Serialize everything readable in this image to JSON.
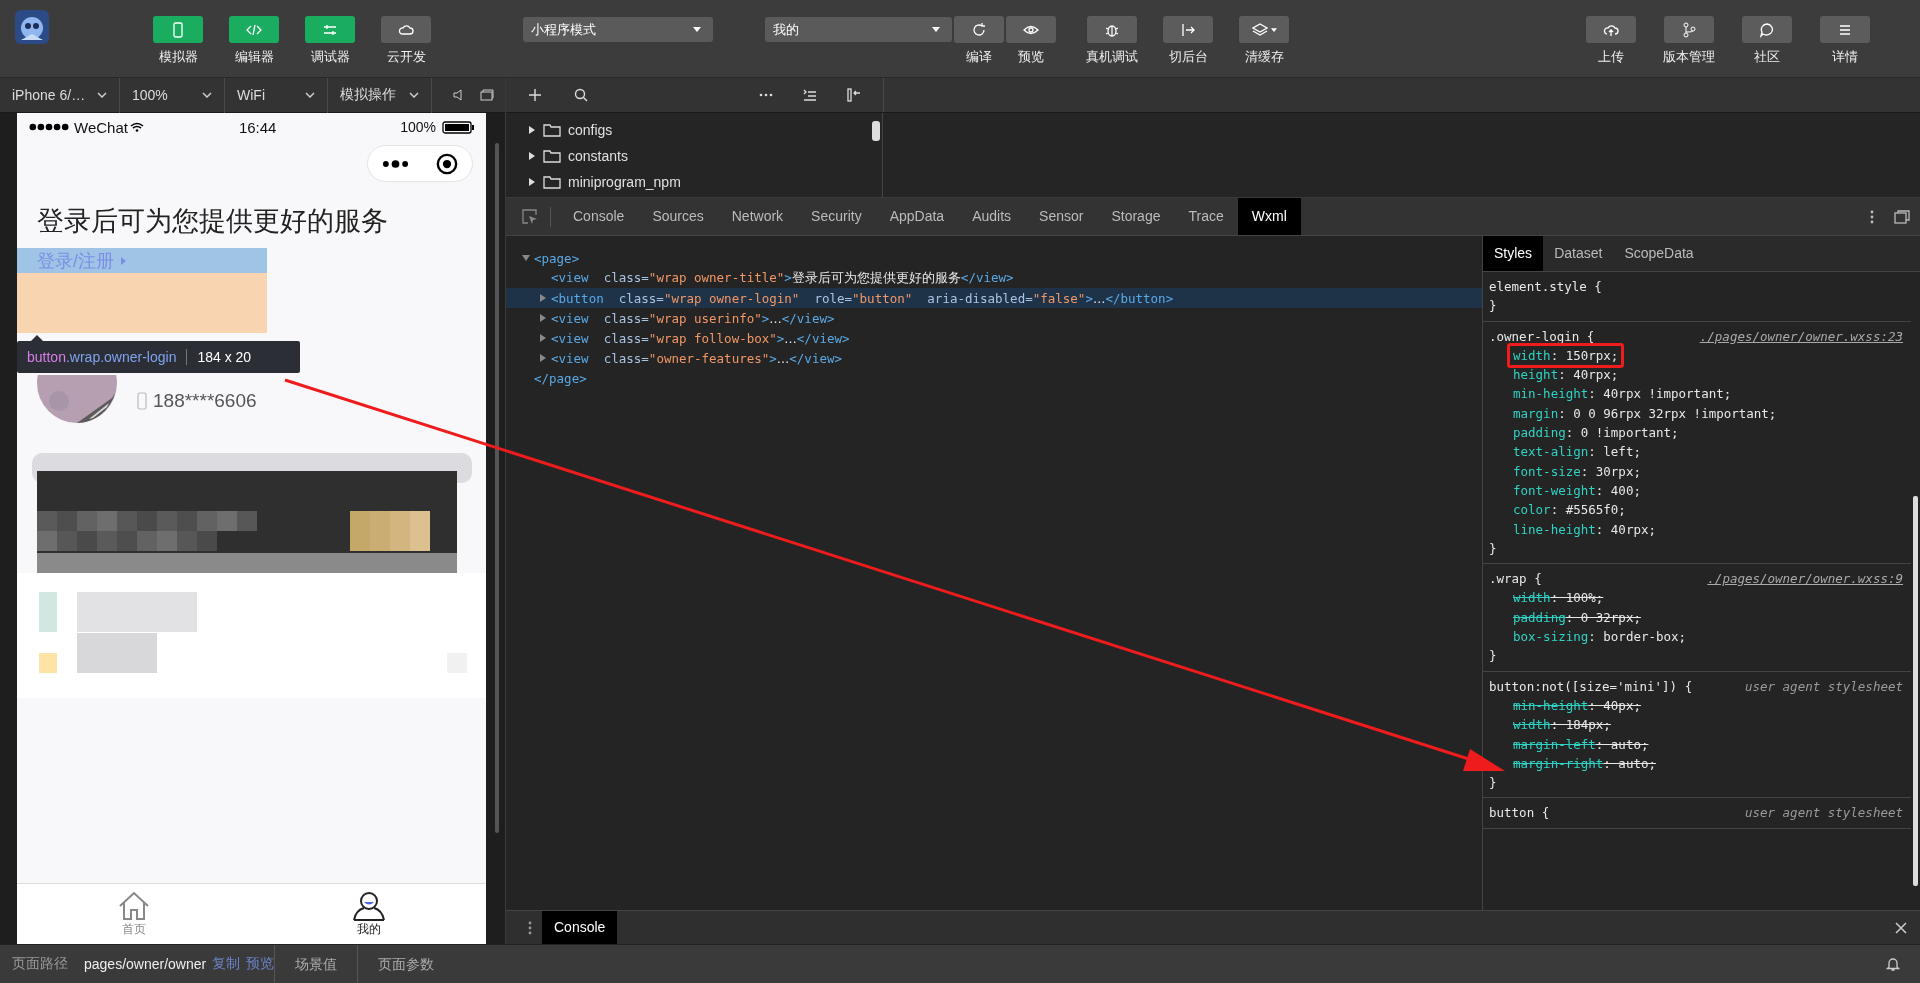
{
  "toolbar": {
    "left": [
      {
        "label": "模拟器",
        "kind": "phone",
        "on": true
      },
      {
        "label": "编辑器",
        "kind": "code",
        "on": true
      },
      {
        "label": "调试器",
        "kind": "sliders",
        "on": true
      },
      {
        "label": "云开发",
        "kind": "cloud",
        "on": false
      }
    ],
    "mode": "小程序模式",
    "compile_mode": "我的",
    "actions": [
      {
        "label": "编译",
        "kind": "refresh"
      },
      {
        "label": "预览",
        "kind": "eye"
      },
      {
        "label": "真机调试",
        "kind": "bug"
      },
      {
        "label": "切后台",
        "kind": "switch"
      },
      {
        "label": "清缓存",
        "kind": "layers",
        "dropdown": true
      }
    ],
    "right": [
      {
        "label": "上传",
        "kind": "upload"
      },
      {
        "label": "版本管理",
        "kind": "branch"
      },
      {
        "label": "社区",
        "kind": "chat"
      },
      {
        "label": "详情",
        "kind": "menu"
      }
    ]
  },
  "simulator": {
    "controls": [
      "iPhone 6/…",
      "100%",
      "WiFi",
      "模拟操作"
    ],
    "phone": {
      "carrier": "WeChat",
      "time": "16:44",
      "battery": "100%",
      "title": "登录后可为您提供更好的服务",
      "login": "登录/注册",
      "phone_number": "188****6606",
      "tabs": [
        {
          "label": "首页",
          "kind": "home",
          "selected": false
        },
        {
          "label": "我的",
          "kind": "user",
          "selected": true
        }
      ]
    },
    "inspector": {
      "tag": "button",
      "classes": ".wrap.owner-login",
      "size": "184 x 20"
    }
  },
  "explorer": {
    "folders": [
      {
        "name": "configs",
        "expanded": false
      },
      {
        "name": "constants",
        "expanded": false
      },
      {
        "name": "miniprogram_npm",
        "expanded": false
      }
    ]
  },
  "devtools": {
    "tabs": [
      {
        "label": "Console",
        "selected": false
      },
      {
        "label": "Sources",
        "selected": false
      },
      {
        "label": "Network",
        "selected": false
      },
      {
        "label": "Security",
        "selected": false
      },
      {
        "label": "AppData",
        "selected": false
      },
      {
        "label": "Audits",
        "selected": false
      },
      {
        "label": "Sensor",
        "selected": false
      },
      {
        "label": "Storage",
        "selected": false
      },
      {
        "label": "Trace",
        "selected": false
      },
      {
        "label": "Wxml",
        "selected": true
      }
    ],
    "wxml": {
      "tokens": [
        {
          "kind": "tag",
          "text": "<page>"
        }
      ],
      "expanded": true,
      "selected": false,
      "closing": [
        {
          "kind": "tag",
          "text": "</page>"
        }
      ],
      "children": [
        {
          "tokens": [
            {
              "kind": "tag",
              "text": "<view"
            },
            {
              "kind": "attr",
              "text": "  class="
            },
            {
              "kind": "value",
              "text": "\"wrap owner-title\""
            },
            {
              "kind": "tag",
              "text": ">"
            },
            {
              "kind": "text",
              "text": "登录后可为您提供更好的服务"
            },
            {
              "kind": "tag",
              "text": "</view>"
            }
          ],
          "selected": false
        },
        {
          "tokens": [
            {
              "kind": "tag",
              "text": "<button"
            },
            {
              "kind": "attr",
              "text": "  class="
            },
            {
              "kind": "value",
              "text": "\"wrap owner-login\""
            },
            {
              "kind": "attr",
              "text": "  role="
            },
            {
              "kind": "value",
              "text": "\"button\""
            },
            {
              "kind": "attr",
              "text": "  aria-disabled="
            },
            {
              "kind": "value",
              "text": "\"false\""
            },
            {
              "kind": "tag",
              "text": ">"
            },
            {
              "kind": "text",
              "text": "…"
            },
            {
              "kind": "tag",
              "text": "</button>"
            }
          ],
          "expanded": false,
          "selected": true
        },
        {
          "tokens": [
            {
              "kind": "tag",
              "text": "<view"
            },
            {
              "kind": "attr",
              "text": "  class="
            },
            {
              "kind": "value",
              "text": "\"wrap userinfo\""
            },
            {
              "kind": "tag",
              "text": ">"
            },
            {
              "kind": "text",
              "text": "…"
            },
            {
              "kind": "tag",
              "text": "</view>"
            }
          ],
          "expanded": false,
          "selected": false
        },
        {
          "tokens": [
            {
              "kind": "tag",
              "text": "<view"
            },
            {
              "kind": "attr",
              "text": "  class="
            },
            {
              "kind": "value",
              "text": "\"wrap follow-box\""
            },
            {
              "kind": "tag",
              "text": ">"
            },
            {
              "kind": "text",
              "text": "…"
            },
            {
              "kind": "tag",
              "text": "</view>"
            }
          ],
          "expanded": false,
          "selected": false
        },
        {
          "tokens": [
            {
              "kind": "tag",
              "text": "<view"
            },
            {
              "kind": "attr",
              "text": "  class="
            },
            {
              "kind": "value",
              "text": "\"owner-features\""
            },
            {
              "kind": "tag",
              "text": ">"
            },
            {
              "kind": "text",
              "text": "…"
            },
            {
              "kind": "tag",
              "text": "</view>"
            }
          ],
          "expanded": false,
          "selected": false
        }
      ]
    },
    "style_tabs": [
      {
        "label": "Styles",
        "selected": true
      },
      {
        "label": "Dataset",
        "selected": false
      },
      {
        "label": "ScopeData",
        "selected": false
      }
    ],
    "rules": [
      {
        "selector": "element.style {",
        "close": "}"
      },
      {
        "selector": ".owner-login {",
        "source": "./pages/owner/owner.wxss:23",
        "kind": "file",
        "close": "}",
        "props": [
          {
            "name": "width",
            "value": ": 150rpx;",
            "struck": false,
            "highlighted": true
          },
          {
            "name": "height",
            "value": ": 40rpx;",
            "struck": false,
            "highlighted": false
          },
          {
            "name": "min-height",
            "value": ": 40rpx !important;",
            "struck": false,
            "highlighted": false
          },
          {
            "name": "margin",
            "value": ": 0 0 96rpx 32rpx !important;",
            "struck": false,
            "highlighted": false
          },
          {
            "name": "padding",
            "value": ": 0 !important;",
            "struck": false,
            "highlighted": false
          },
          {
            "name": "text-align",
            "value": ": left;",
            "struck": false,
            "highlighted": false
          },
          {
            "name": "font-size",
            "value": ": 30rpx;",
            "struck": false,
            "highlighted": false
          },
          {
            "name": "font-weight",
            "value": ": 400;",
            "struck": false,
            "highlighted": false
          },
          {
            "name": "color",
            "value": ": #5565f0;",
            "struck": false,
            "highlighted": false
          },
          {
            "name": "line-height",
            "value": ": 40rpx;",
            "struck": false,
            "highlighted": false
          }
        ]
      },
      {
        "selector": ".wrap {",
        "source": "./pages/owner/owner.wxss:9",
        "kind": "file",
        "close": "}",
        "props": [
          {
            "name": "width",
            "value": ": 100%;",
            "struck": true,
            "highlighted": false
          },
          {
            "name": "padding",
            "value": ": 0 32rpx;",
            "struck": true,
            "highlighted": false
          },
          {
            "name": "box-sizing",
            "value": ": border-box;",
            "struck": false,
            "highlighted": false
          }
        ]
      },
      {
        "selector": "button:not([size='mini']) {",
        "source": "user agent stylesheet",
        "kind": "user-agent",
        "close": "}",
        "props": [
          {
            "name": "min-height",
            "value": ": 40px;",
            "struck": true,
            "highlighted": false
          },
          {
            "name": "width",
            "value": ": 184px;",
            "struck": true,
            "highlighted": false
          },
          {
            "name": "margin-left",
            "value": ": auto;",
            "struck": true,
            "highlighted": false
          },
          {
            "name": "margin-right",
            "value": ": auto;",
            "struck": true,
            "highlighted": false
          }
        ]
      },
      {
        "selector": "button {",
        "source": "user agent stylesheet",
        "kind": "user-agent"
      }
    ]
  },
  "drawer": {
    "tabs": [
      {
        "label": "Console",
        "selected": true
      }
    ]
  },
  "status_bar": {
    "path_label": "页面路径",
    "path": "pages/owner/owner",
    "links": [
      "复制",
      "预览"
    ],
    "items": [
      "场景值",
      "页面参数"
    ]
  }
}
